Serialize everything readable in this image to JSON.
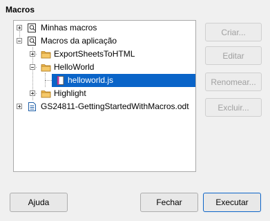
{
  "dialog": {
    "section_title": "Macros"
  },
  "tree": {
    "items": [
      {
        "label": "Minhas macros",
        "icon": "macro-library-icon",
        "expanded": false
      },
      {
        "label": "Macros da aplicação",
        "icon": "macro-library-icon",
        "expanded": true
      },
      {
        "label": "ExportSheetsToHTML",
        "icon": "folder-icon",
        "expanded": false
      },
      {
        "label": "HelloWorld",
        "icon": "folder-icon",
        "expanded": true
      },
      {
        "label": "helloworld.js",
        "icon": "script-file-icon",
        "selected": true
      },
      {
        "label": "Highlight",
        "icon": "folder-icon",
        "expanded": false
      },
      {
        "label": "GS24811-GettingStartedWithMacros.odt",
        "icon": "document-icon",
        "expanded": false
      }
    ]
  },
  "actions": {
    "create": "Criar...",
    "edit": "Editar",
    "rename": "Renomear...",
    "delete": "Excluir..."
  },
  "footer": {
    "help": "Ajuda",
    "close": "Fechar",
    "run": "Executar"
  },
  "colors": {
    "selection": "#0a64c8",
    "folder": "#f0b84c"
  }
}
